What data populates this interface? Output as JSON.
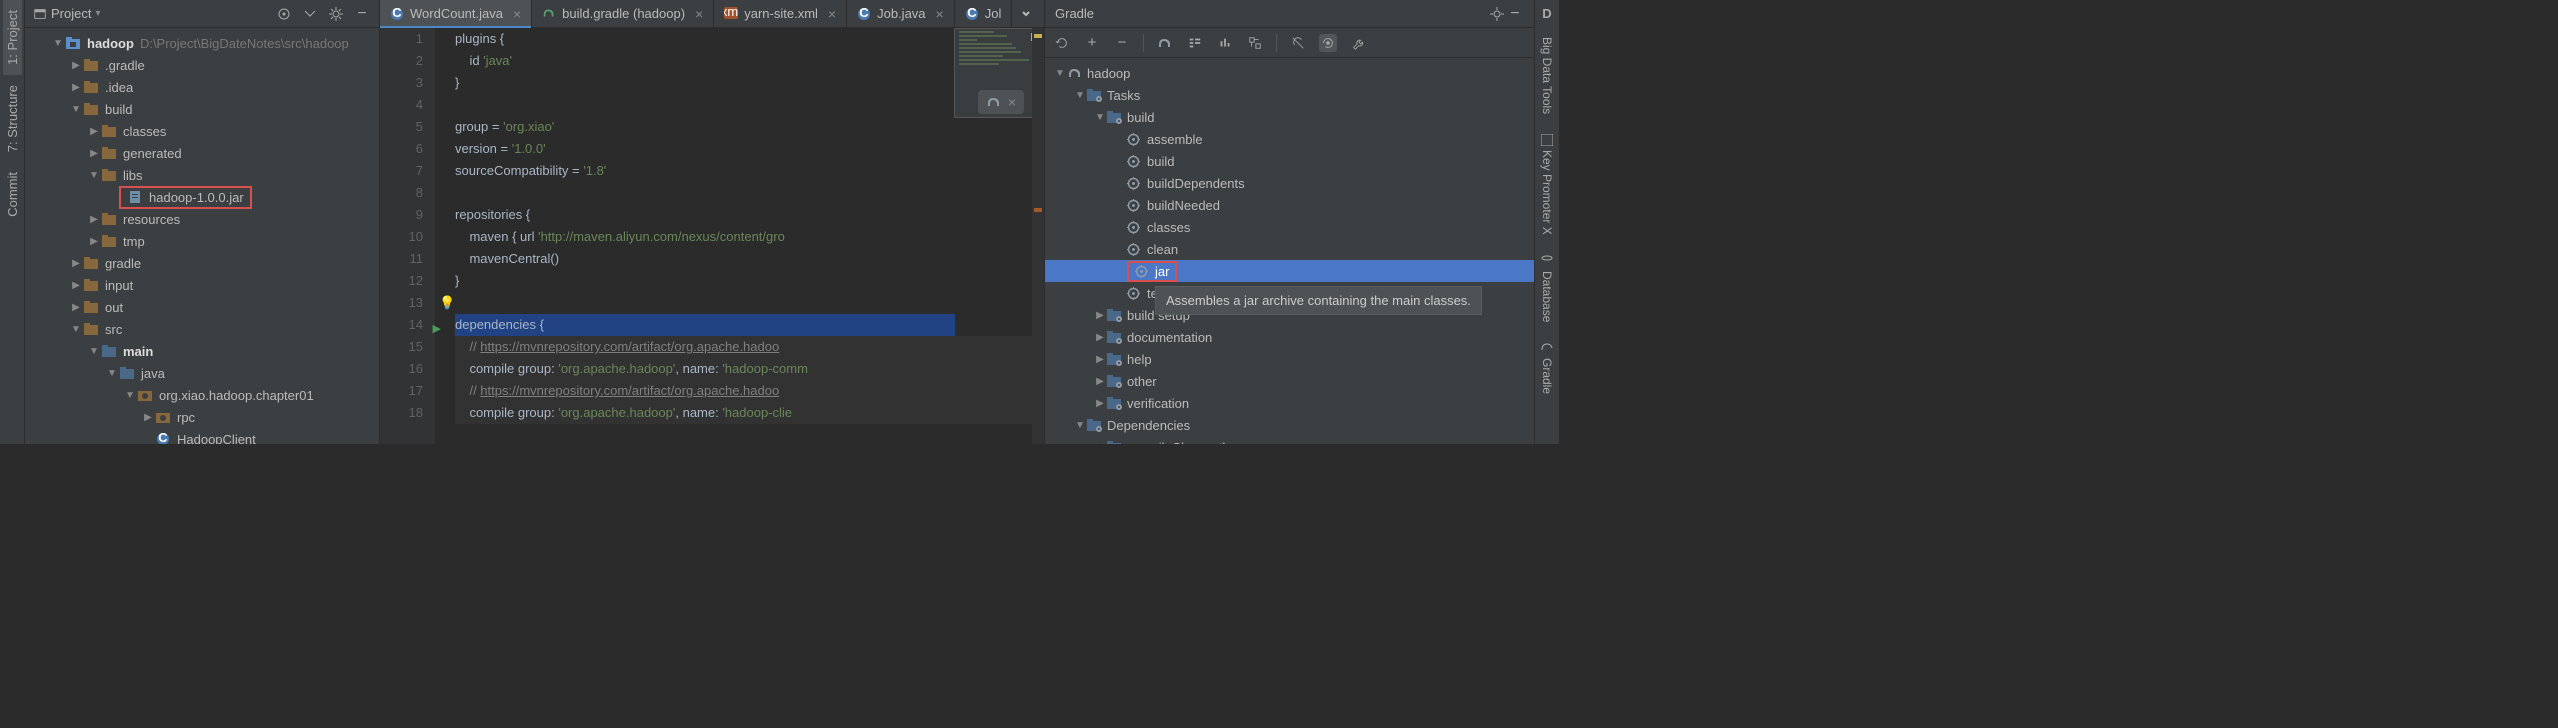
{
  "left_rail": {
    "items": [
      {
        "label": "1: Project",
        "selected": true
      },
      {
        "label": "7: Structure",
        "selected": false
      },
      {
        "label": "Commit",
        "selected": false
      }
    ]
  },
  "right_rail": {
    "items": [
      {
        "label": "D",
        "sub": "Big Data Tools"
      },
      {
        "label": "Key Promoter X"
      },
      {
        "label": "Database"
      },
      {
        "label": "Gradle"
      }
    ]
  },
  "project_panel": {
    "title": "Project",
    "root": {
      "name": "hadoop",
      "path": "D:\\Project\\BigDateNotes\\src\\hadoop"
    },
    "tree": [
      {
        "indent": 1,
        "arrow": "down",
        "icon": "module",
        "label": "hadoop",
        "bold": true,
        "path": "D:\\Project\\BigDateNotes\\src\\hadoop"
      },
      {
        "indent": 2,
        "arrow": "right",
        "icon": "folder",
        "label": ".gradle"
      },
      {
        "indent": 2,
        "arrow": "right",
        "icon": "folder",
        "label": ".idea"
      },
      {
        "indent": 2,
        "arrow": "down",
        "icon": "folder",
        "label": "build"
      },
      {
        "indent": 3,
        "arrow": "right",
        "icon": "folder",
        "label": "classes"
      },
      {
        "indent": 3,
        "arrow": "right",
        "icon": "folder",
        "label": "generated"
      },
      {
        "indent": 3,
        "arrow": "down",
        "icon": "folder",
        "label": "libs"
      },
      {
        "indent": 4,
        "arrow": "",
        "icon": "jar",
        "label": "hadoop-1.0.0.jar",
        "highlighted": true
      },
      {
        "indent": 3,
        "arrow": "right",
        "icon": "folder",
        "label": "resources"
      },
      {
        "indent": 3,
        "arrow": "right",
        "icon": "folder",
        "label": "tmp"
      },
      {
        "indent": 2,
        "arrow": "right",
        "icon": "folder",
        "label": "gradle"
      },
      {
        "indent": 2,
        "arrow": "right",
        "icon": "folder",
        "label": "input"
      },
      {
        "indent": 2,
        "arrow": "right",
        "icon": "folder",
        "label": "out"
      },
      {
        "indent": 2,
        "arrow": "down",
        "icon": "folder",
        "label": "src"
      },
      {
        "indent": 3,
        "arrow": "down",
        "icon": "bluefolder",
        "label": "main",
        "bold": true
      },
      {
        "indent": 4,
        "arrow": "down",
        "icon": "bluefolder",
        "label": "java"
      },
      {
        "indent": 5,
        "arrow": "down",
        "icon": "package",
        "label": "org.xiao.hadoop.chapter01"
      },
      {
        "indent": 6,
        "arrow": "right",
        "icon": "package",
        "label": "rpc"
      },
      {
        "indent": 6,
        "arrow": "",
        "icon": "class",
        "label": "HadoopClient"
      }
    ]
  },
  "editor": {
    "tabs": [
      {
        "label": "WordCount.java",
        "icon": "class",
        "active": true
      },
      {
        "label": "build.gradle (hadoop)",
        "icon": "gradle",
        "active": false
      },
      {
        "label": "yarn-site.xml",
        "icon": "xml",
        "active": false
      },
      {
        "label": "Job.java",
        "icon": "class",
        "active": false
      },
      {
        "label": "Jol",
        "icon": "class",
        "active": false,
        "truncated": true
      }
    ],
    "lines": [
      {
        "n": 1,
        "html": "plugins {"
      },
      {
        "n": 2,
        "html": "    id <span class='str'>'java'</span>"
      },
      {
        "n": 3,
        "html": "}"
      },
      {
        "n": 4,
        "html": ""
      },
      {
        "n": 5,
        "html": "group = <span class='str'>'org.xiao'</span>"
      },
      {
        "n": 6,
        "html": "version = <span class='str'>'1.0.0'</span>"
      },
      {
        "n": 7,
        "html": "sourceCompatibility = <span class='str'>'1.8'</span>"
      },
      {
        "n": 8,
        "html": ""
      },
      {
        "n": 9,
        "html": "repositories {"
      },
      {
        "n": 10,
        "html": "    maven { url <span class='str'>'http://maven.aliyun.com/nexus/content/gro</span>"
      },
      {
        "n": 11,
        "html": "    mavenCentral()"
      },
      {
        "n": 12,
        "html": "}"
      },
      {
        "n": 13,
        "html": "",
        "bulb": true
      },
      {
        "n": 14,
        "html": "dependencies {",
        "run": true,
        "selected": true
      },
      {
        "n": 15,
        "html": "    <span class='com'>// <span class='link'>https://mvnrepository.com/artifact/org.apache.hadoo</span></span>",
        "hl": true
      },
      {
        "n": 16,
        "html": "    compile <span class='hl'>group: <span class='str'>'org.apache.hadoop'</span>, name: <span class='str'>'hadoop-comm</span></span>",
        "hl": true
      },
      {
        "n": 17,
        "html": "    <span class='com'>// <span class='link'>https://mvnrepository.com/artifact/org.apache.hadoo</span></span>",
        "hl": true
      },
      {
        "n": 18,
        "html": "    compile <span class='hl'>group: <span class='str'>'org.apache.hadoop'</span>, name: <span class='str'>'hadoop-clie</span></span>",
        "hl": true
      }
    ]
  },
  "gradle": {
    "title": "Gradle",
    "tree": [
      {
        "indent": 0,
        "arrow": "down",
        "icon": "elephant",
        "label": "hadoop"
      },
      {
        "indent": 1,
        "arrow": "down",
        "icon": "folder-gear",
        "label": "Tasks"
      },
      {
        "indent": 2,
        "arrow": "down",
        "icon": "folder-gear",
        "label": "build"
      },
      {
        "indent": 3,
        "arrow": "",
        "icon": "task",
        "label": "assemble"
      },
      {
        "indent": 3,
        "arrow": "",
        "icon": "task",
        "label": "build"
      },
      {
        "indent": 3,
        "arrow": "",
        "icon": "task",
        "label": "buildDependents"
      },
      {
        "indent": 3,
        "arrow": "",
        "icon": "task",
        "label": "buildNeeded"
      },
      {
        "indent": 3,
        "arrow": "",
        "icon": "task",
        "label": "classes"
      },
      {
        "indent": 3,
        "arrow": "",
        "icon": "task",
        "label": "clean"
      },
      {
        "indent": 3,
        "arrow": "",
        "icon": "task",
        "label": "jar",
        "selected": true,
        "highlighted": true
      },
      {
        "indent": 3,
        "arrow": "",
        "icon": "task",
        "label": "testClasses"
      },
      {
        "indent": 2,
        "arrow": "right",
        "icon": "folder-gear",
        "label": "build setup"
      },
      {
        "indent": 2,
        "arrow": "right",
        "icon": "folder-gear",
        "label": "documentation"
      },
      {
        "indent": 2,
        "arrow": "right",
        "icon": "folder-gear",
        "label": "help"
      },
      {
        "indent": 2,
        "arrow": "right",
        "icon": "folder-gear",
        "label": "other"
      },
      {
        "indent": 2,
        "arrow": "right",
        "icon": "folder-gear",
        "label": "verification"
      },
      {
        "indent": 1,
        "arrow": "down",
        "icon": "folder-gear",
        "label": "Dependencies"
      },
      {
        "indent": 2,
        "arrow": "right",
        "icon": "folder-gear",
        "label": "compileClasspath"
      }
    ],
    "tooltip": "Assembles a jar archive containing the main classes."
  }
}
